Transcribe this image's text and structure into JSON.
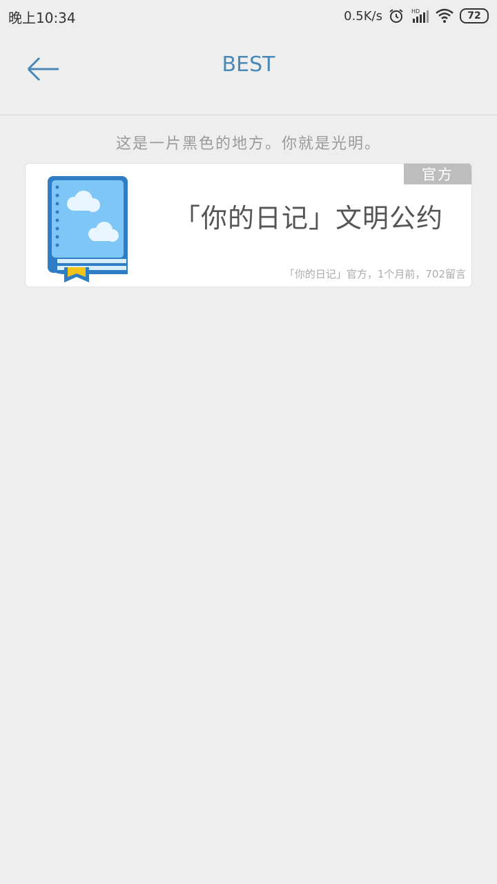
{
  "status_bar": {
    "time": "晚上10:34",
    "network_speed": "0.5K/s",
    "battery": "72",
    "icons": [
      "alarm-icon",
      "signal-icon",
      "wifi-icon",
      "battery-icon"
    ]
  },
  "header": {
    "title": "BEST",
    "back_icon": "back-arrow-icon"
  },
  "subtitle": "这是一片黑色的地方。你就是光明。",
  "card": {
    "badge": "官方",
    "title": "「你的日记」文明公约",
    "meta": "「你的日记」官方，1个月前，702留言",
    "thumbnail_icon": "diary-book-icon"
  },
  "colors": {
    "accent": "#4a88b8",
    "background": "#eeeeee",
    "card": "#ffffff",
    "badge": "#bdbdbd"
  }
}
